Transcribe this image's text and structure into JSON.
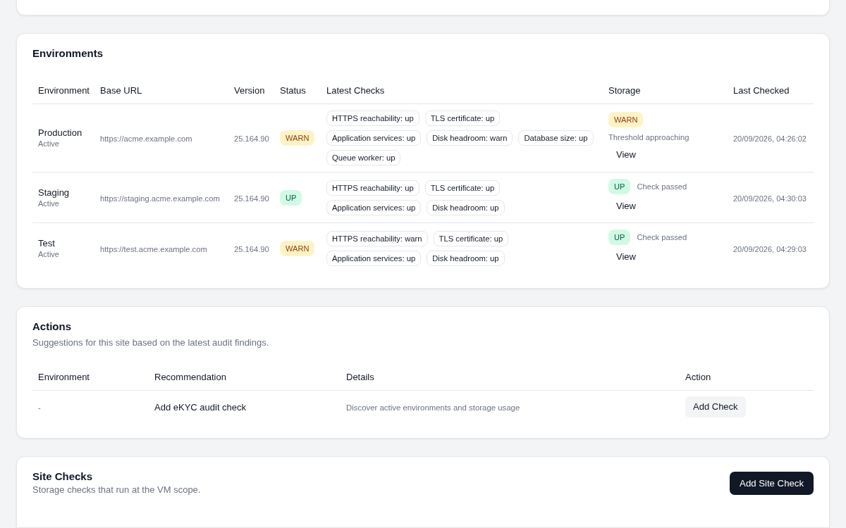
{
  "environments": {
    "title": "Environments",
    "columns": [
      "Environment",
      "Base URL",
      "Version",
      "Status",
      "Latest Checks",
      "Storage",
      "Last Checked"
    ],
    "rows": [
      {
        "name": "Production",
        "state": "Active",
        "base_url": "https://acme.example.com",
        "version": "25.164.90",
        "status": {
          "kind": "warn",
          "label": "WARN"
        },
        "checks": [
          "HTTPS reachability: up",
          "TLS certificate: up",
          "Application services: up",
          "Disk headroom: warn",
          "Database size: up",
          "Queue worker: up"
        ],
        "storage": {
          "status": {
            "kind": "warn",
            "label": "WARN"
          },
          "note": "Threshold approaching",
          "action": "View"
        },
        "last_checked": "20/09/2026, 04:26:02"
      },
      {
        "name": "Staging",
        "state": "Active",
        "base_url": "https://staging.acme.example.com",
        "version": "25.164.90",
        "status": {
          "kind": "up",
          "label": "UP"
        },
        "checks": [
          "HTTPS reachability: up",
          "TLS certificate: up",
          "Application services: up",
          "Disk headroom: up"
        ],
        "storage": {
          "status": {
            "kind": "up",
            "label": "UP"
          },
          "note": "Check passed",
          "action": "View"
        },
        "last_checked": "20/09/2026, 04:30:03"
      },
      {
        "name": "Test",
        "state": "Active",
        "base_url": "https://test.acme.example.com",
        "version": "25.164.90",
        "status": {
          "kind": "warn",
          "label": "WARN"
        },
        "checks": [
          "HTTPS reachability: warn",
          "TLS certificate: up",
          "Application services: up",
          "Disk headroom: up"
        ],
        "storage": {
          "status": {
            "kind": "up",
            "label": "UP"
          },
          "note": "Check passed",
          "action": "View"
        },
        "last_checked": "20/09/2026, 04:29:03"
      }
    ]
  },
  "actions": {
    "title": "Actions",
    "subtitle": "Suggestions for this site based on the latest audit findings.",
    "columns": [
      "Environment",
      "Recommendation",
      "Details",
      "Action"
    ],
    "rows": [
      {
        "environment": "-",
        "recommendation": "Add eKYC audit check",
        "details": "Discover active environments and storage usage",
        "action": "Add Check"
      }
    ]
  },
  "site_checks": {
    "title": "Site Checks",
    "subtitle": "Storage checks that run at the VM scope.",
    "button": "Add Site Check"
  }
}
